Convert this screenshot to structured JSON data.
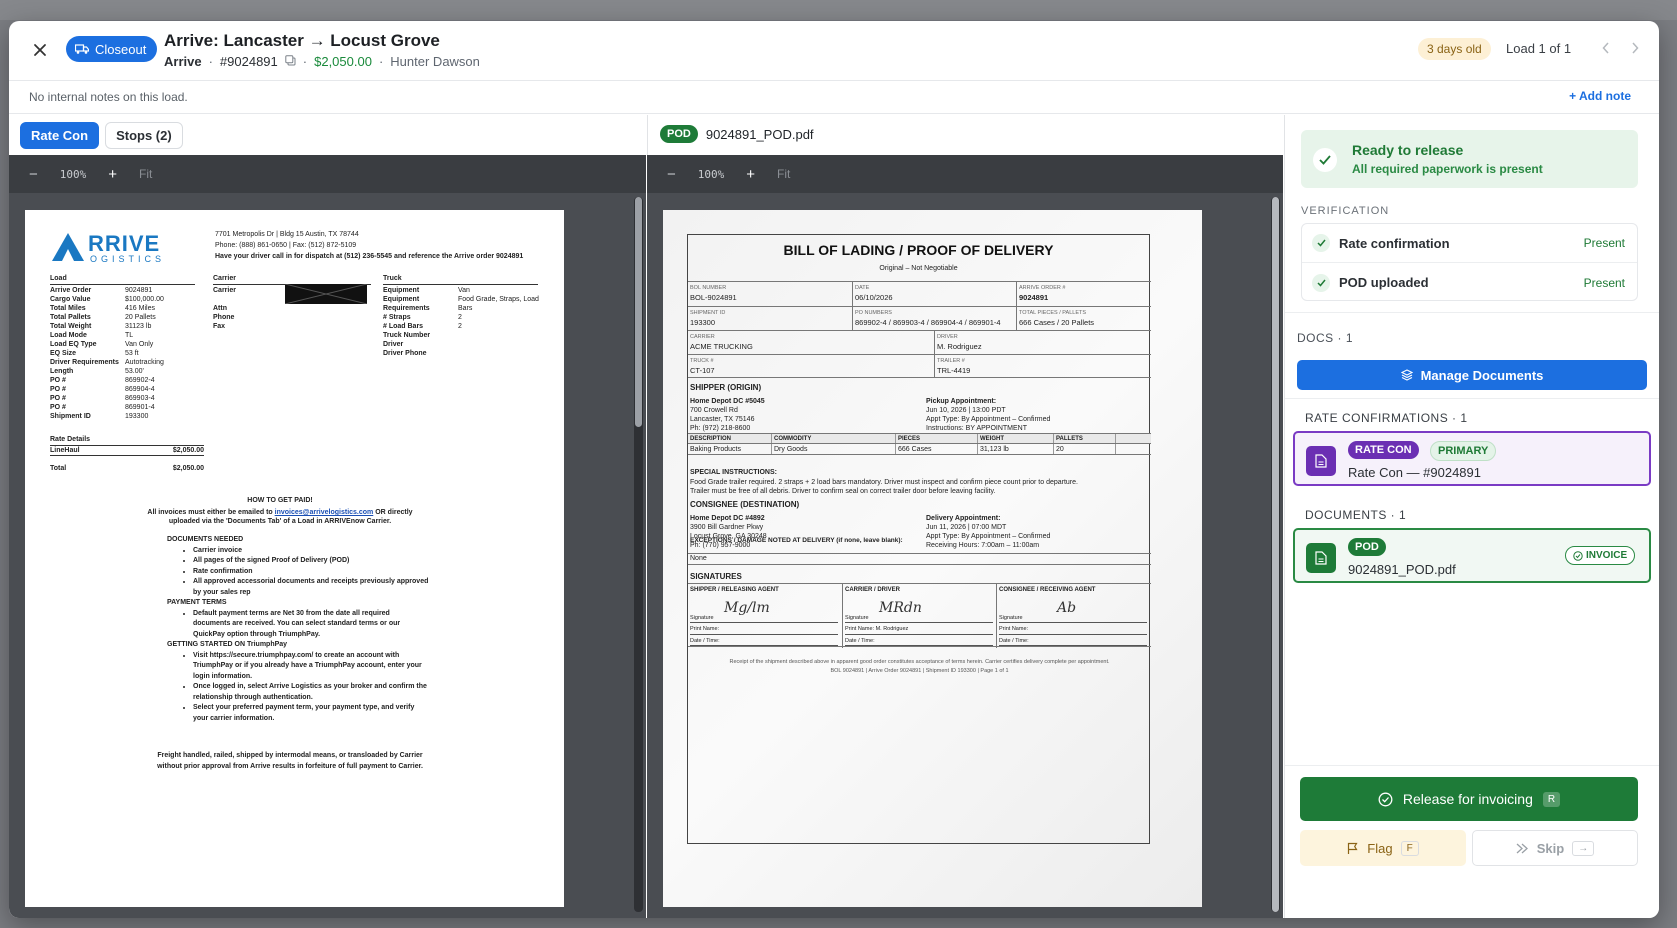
{
  "header": {
    "status_chip": "Closeout",
    "title": "Arrive: Lancaster → Locust Grove",
    "broker": "Arrive",
    "order": "#9024891",
    "amount": "$2,050.00",
    "dispatcher": "Hunter Dawson",
    "sep": "·",
    "age": "3 days old",
    "load_of": "Load 1 of 1"
  },
  "notes": {
    "text": "No internal notes on this load.",
    "add_label": "+ Add note"
  },
  "left_panel": {
    "tabs": [
      {
        "label": "Rate Con",
        "active": true
      },
      {
        "label": "Stops (2)",
        "active": false
      }
    ],
    "zoom": "100%",
    "fit": "Fit",
    "minus": "−",
    "plus": "+"
  },
  "rate_con": {
    "logo_main": "ARRIVE",
    "logo_sub": "LOGISTICS",
    "addr1": "7701 Metropolis Dr | Bldg 15 Austin, TX 78744",
    "addr2": "Phone: (888) 861-0650 | Fax: (512) 872-5109",
    "addr3": "Have your driver call in for dispatch at (512) 236-5545 and reference the Arrive order 9024891",
    "load_title": "Load",
    "load_rows": [
      [
        "Arrive Order",
        "9024891"
      ],
      [
        "Cargo Value",
        "$100,000.00"
      ],
      [
        "Total Miles",
        "416 Miles"
      ],
      [
        "Total Pallets",
        "20 Pallets"
      ],
      [
        "Total Weight",
        "31123 lb"
      ],
      [
        "Load Mode",
        "TL"
      ],
      [
        "Load EQ Type",
        "Van Only"
      ],
      [
        "EQ Size",
        "53 ft"
      ],
      [
        "Driver Requirements",
        "Autotracking"
      ],
      [
        "Length",
        "53.00'"
      ],
      [
        "PO #",
        "869902-4"
      ],
      [
        "PO #",
        "869904-4"
      ],
      [
        "PO #",
        "869903-4"
      ],
      [
        "PO #",
        "869901-4"
      ],
      [
        "Shipment ID",
        "193300"
      ]
    ],
    "carrier_title": "Carrier",
    "carrier_rows": [
      "Carrier",
      "Attn",
      "Phone",
      "Fax"
    ],
    "truck_title": "Truck",
    "truck_rows": [
      [
        "Equipment",
        "Van"
      ],
      [
        "Equipment Requirements",
        "Food Grade, Straps, Load Bars"
      ],
      [
        "# Straps",
        "2"
      ],
      [
        "# Load Bars",
        "2"
      ],
      [
        "Truck Number",
        ""
      ],
      [
        "Driver",
        ""
      ],
      [
        "Driver Phone",
        ""
      ]
    ],
    "rate_details": "Rate Details",
    "linehaul_label": "LineHaul",
    "linehaul": "$2,050.00",
    "total_label": "Total",
    "total": "$2,050.00",
    "how_title": "HOW TO GET PAID!",
    "how_p1a": "All invoices must either be emailed to ",
    "how_email": "invoices@arrivelogistics.com",
    "how_p1b": " OR directly uploaded via the 'Documents Tab' of a Load in ARRIVEnow Carrier.",
    "docs_needed": "DOCUMENTS NEEDED",
    "docs_items": [
      "Carrier invoice",
      "All pages of the signed Proof of Delivery (POD)",
      "Rate confirmation",
      "All approved accessorial documents and receipts previously approved by your sales rep"
    ],
    "payment_terms": "PAYMENT TERMS",
    "payment_items": [
      "Default payment terms are Net 30 from the date all required documents are received. You can select standard terms or our QuickPay option through TriumphPay."
    ],
    "getting_started": "GETTING STARTED ON TriumphPay",
    "gs_items": [
      "Visit https://secure.triumphpay.com/ to create an account with TriumphPay or if you already have a TriumphPay account, enter your login information.",
      "Once logged in, select Arrive Logistics as your broker and confirm the relationship through authentication.",
      "Select your preferred payment term, your payment type, and verify your carrier information."
    ],
    "footer": "Freight handled, railed, shipped by intermodal means, or transloaded by Carrier without prior approval from Arrive results in forfeiture of full payment to Carrier."
  },
  "pod_panel": {
    "badge": "POD",
    "filename": "9024891_POD.pdf",
    "zoom": "100%",
    "fit": "Fit",
    "minus": "−",
    "plus": "+"
  },
  "bol": {
    "title": "BILL OF LADING / PROOF OF DELIVERY",
    "subtitle": "Original – Not Negotiable",
    "bol_label": "BOL NUMBER",
    "bol": "BOL-9024891",
    "date_label": "DATE",
    "date": "06/10/2026",
    "order_label": "ARRIVE ORDER #",
    "order": "9024891",
    "ship_label": "SHIPMENT ID",
    "ship": "193300",
    "po_label": "PO NUMBERS",
    "po": "869902-4 / 869903-4 / 869904-4 / 869901-4",
    "pieces_label": "TOTAL PIECES / PALLETS",
    "pieces": "666 Cases / 20 Pallets",
    "carrier_label": "CARRIER",
    "carrier": "ACME TRUCKING",
    "driver_label": "DRIVER",
    "driver": "M. Rodriguez",
    "truck_label": "TRUCK #",
    "truck": "CT-107",
    "trailer_label": "TRAILER #",
    "trailer": "TRL-4419",
    "shipper_title": "SHIPPER (ORIGIN)",
    "shipper_lines": [
      "Home Depot DC #5045",
      "700 Crowell Rd",
      "Lancaster, TX 75146",
      "Ph: (972) 218-8600"
    ],
    "pickup_lines": [
      "Pickup Appointment:",
      "Jun 10, 2026 | 13:00 PDT",
      "Appt Type: By Appointment – Confirmed",
      "Instructions: BY APPOINTMENT"
    ],
    "cols": [
      "DESCRIPTION",
      "COMMODITY",
      "PIECES",
      "WEIGHT",
      "PALLETS"
    ],
    "row": [
      "Baking Products",
      "Dry Goods",
      "666 Cases",
      "31,123 lb",
      "20"
    ],
    "special_title": "SPECIAL INSTRUCTIONS:",
    "special1": "Food Grade trailer required. 2 straps + 2 load bars mandatory. Driver must inspect and confirm piece count prior to departure.",
    "special2": "Trailer must be free of all debris. Driver to confirm seal on correct trailer door before leaving facility.",
    "consignee_title": "CONSIGNEE (DESTINATION)",
    "consignee_lines": [
      "Home Depot DC #4892",
      "3900 Bill Gardner Pkwy",
      "Locust Grove, GA 30248",
      "Ph: (770) 957-9000"
    ],
    "delivery_lines": [
      "Delivery Appointment:",
      "Jun 11, 2026 | 07:00 MDT",
      "Appt Type: By Appointment – Confirmed",
      "Receiving Hours: 7:00am – 11:00am"
    ],
    "exceptions": "EXCEPTIONS / DAMAGE NOTED AT DELIVERY (if none, leave blank):",
    "exceptions_val": "None",
    "sig_title": "SIGNATURES",
    "sig_cols": [
      "SHIPPER / RELEASING AGENT",
      "CARRIER / DRIVER",
      "CONSIGNEE / RECEIVING AGENT"
    ],
    "sig_label": "Signature",
    "print_label": "Print Name:",
    "print_driver": "Print Name: M. Rodriguez",
    "date_time": "Date / Time:",
    "sig_marks": [
      "Mg/lm",
      "MRdn",
      "Ab"
    ],
    "receipt": "Receipt of the shipment described above in apparent good order constitutes acceptance of terms herein. Carrier certifies delivery complete per appointment.",
    "receipt2": "BOL 9024891  |  Arrive Order 9024891  |  Shipment ID 193300  |  Page 1 of 1"
  },
  "right_panel": {
    "ready_title": "Ready to release",
    "ready_sub": "All required paperwork is present",
    "verification": "VERIFICATION",
    "checks": [
      {
        "label": "Rate confirmation",
        "status": "Present"
      },
      {
        "label": "POD uploaded",
        "status": "Present"
      }
    ],
    "docs_header": "DOCS · 1",
    "manage": "Manage Documents",
    "rate_conf_header": "RATE CONFIRMATIONS · 1",
    "rc_card": {
      "badge": "RATE CON",
      "primary": "PRIMARY",
      "name": "Rate Con — #9024891"
    },
    "documents_header": "DOCUMENTS · 1",
    "pod_card": {
      "badge": "POD",
      "name": "9024891_POD.pdf",
      "tag": "INVOICE"
    },
    "release": "Release for invoicing",
    "release_key": "R",
    "flag": "Flag",
    "flag_key": "F",
    "skip": "Skip",
    "skip_key": "→"
  },
  "colors": {
    "primary": "#1c6fe0",
    "success": "#1e7b38",
    "purple": "#6b2fb3",
    "warn": "#fdf4dd"
  }
}
